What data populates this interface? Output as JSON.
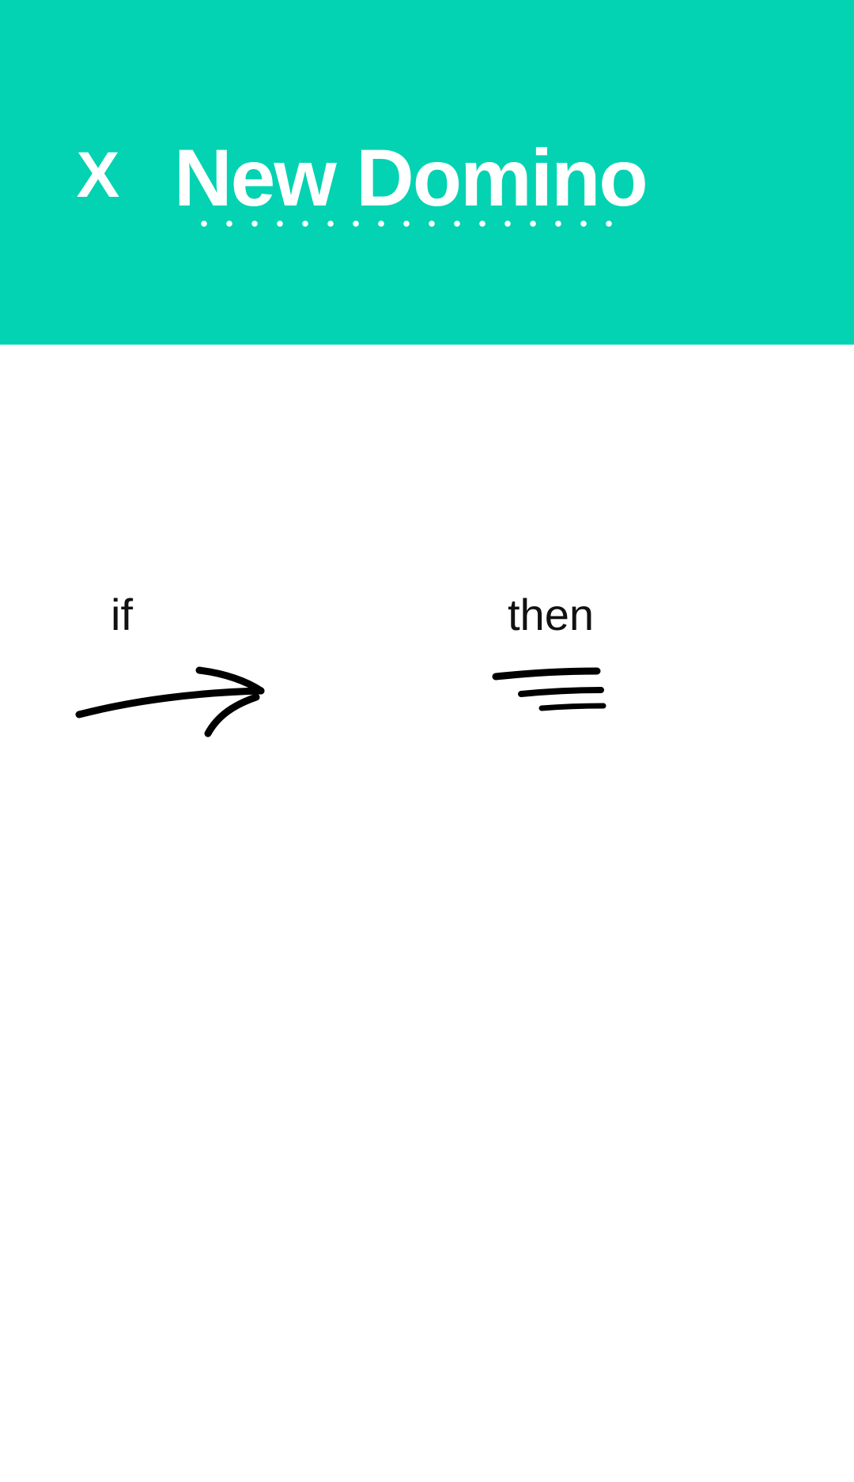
{
  "header": {
    "close_label": "X",
    "title": "New Domino",
    "background_color": "#03d3b2",
    "text_color": "#ffffff"
  },
  "rule": {
    "if_label": "if",
    "then_label": "then",
    "if_icon": "arrow-sketch-icon",
    "then_icon": "text-lines-sketch-icon"
  }
}
